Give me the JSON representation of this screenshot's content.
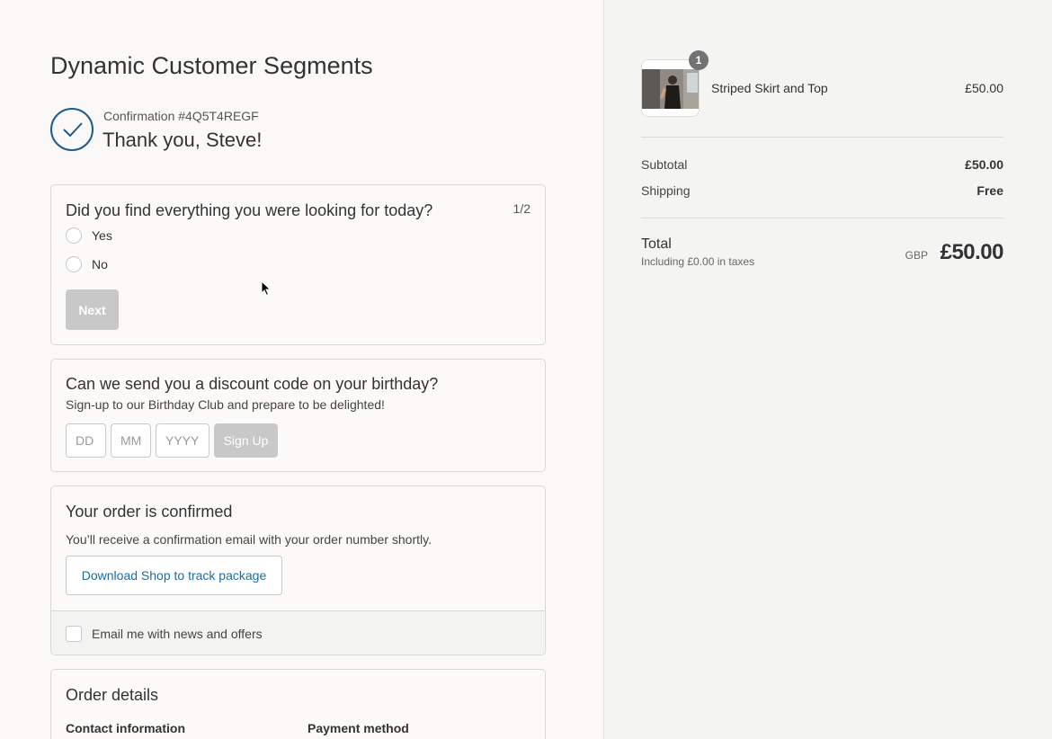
{
  "header": {
    "shop_name": "Dynamic Customer Segments",
    "confirmation_number": "Confirmation #4Q5T4REGF",
    "thank_you": "Thank you, Steve!"
  },
  "survey": {
    "question": "Did you find everything you were looking for today?",
    "step": "1/2",
    "options": [
      {
        "label": "Yes",
        "selected": false
      },
      {
        "label": "No",
        "selected": false
      }
    ],
    "next_label": "Next"
  },
  "birthday": {
    "title": "Can we send you a discount code on your birthday?",
    "subtitle": "Sign-up to our Birthday Club and prepare to be delighted!",
    "day_placeholder": "DD",
    "month_placeholder": "MM",
    "year_placeholder": "YYYY",
    "signup_label": "Sign Up"
  },
  "confirmation": {
    "title": "Your order is confirmed",
    "subtitle": "You’ll receive a confirmation email with your order number shortly.",
    "shop_button": "Download Shop to track package",
    "newsletter_label": "Email me with news and offers",
    "newsletter_checked": false
  },
  "order_details": {
    "title": "Order details",
    "contact_heading": "Contact information",
    "payment_heading": "Payment method"
  },
  "summary": {
    "item": {
      "name": "Striped Skirt and Top",
      "price": "£50.00",
      "quantity": "1"
    },
    "subtotal_label": "Subtotal",
    "subtotal_value": "£50.00",
    "shipping_label": "Shipping",
    "shipping_value": "Free",
    "total_label": "Total",
    "tax_note": "Including £0.00 in taxes",
    "currency": "GBP",
    "total_value": "£50.00"
  },
  "colors": {
    "accent_blue": "#1f5a8a",
    "link_blue": "#1f6a9e",
    "disabled_button": "#c8c8c8"
  }
}
